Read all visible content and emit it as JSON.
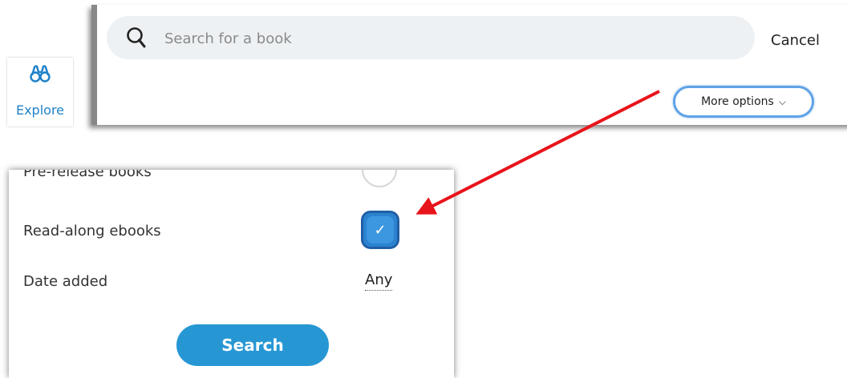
{
  "nav": {
    "explore_label": "Explore"
  },
  "search": {
    "placeholder": "Search for a book",
    "cancel_label": "Cancel"
  },
  "more_options": {
    "label": "More options"
  },
  "filters": {
    "prerelease_label": "Pre-release books",
    "prerelease_checked": false,
    "readalong_label": "Read-along ebooks",
    "readalong_checked": true,
    "date_added_label": "Date added",
    "date_added_value": "Any"
  },
  "search_button_label": "Search",
  "colors": {
    "accent": "#2797d4",
    "highlight_border": "#5fa2e6",
    "annotation_arrow": "#e8141b"
  }
}
